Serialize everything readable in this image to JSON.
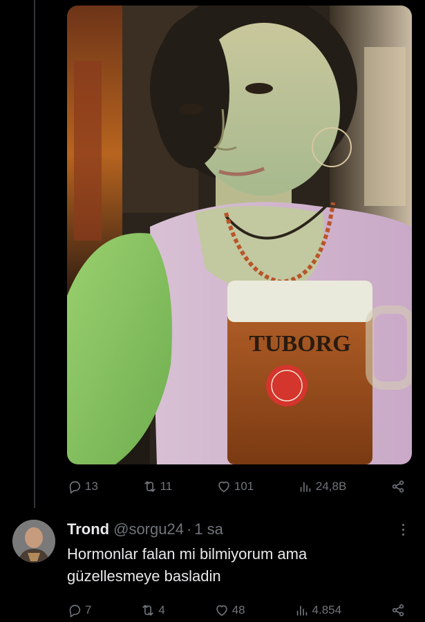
{
  "post": {
    "photo_alt": "",
    "mug_brand": "TUBORG",
    "stats": {
      "replies": "13",
      "reposts": "11",
      "likes": "101",
      "views": "24,8B"
    }
  },
  "reply": {
    "name": "Trond",
    "handle": "@sorgu24",
    "separator": "·",
    "time": "1 sa",
    "text": "Hormonlar falan mi bilmiyorum ama güzellesmeye basladin",
    "stats": {
      "replies": "7",
      "reposts": "4",
      "likes": "48",
      "views": "4.854"
    }
  },
  "icons": {
    "reply": "reply-icon",
    "repost": "repost-icon",
    "like": "heart-icon",
    "views": "views-icon",
    "share": "share-icon",
    "more": "more-icon"
  },
  "colors": {
    "background": "#000000",
    "text": "#e7e9ea",
    "muted": "#71767b",
    "thread_line": "#333639"
  }
}
